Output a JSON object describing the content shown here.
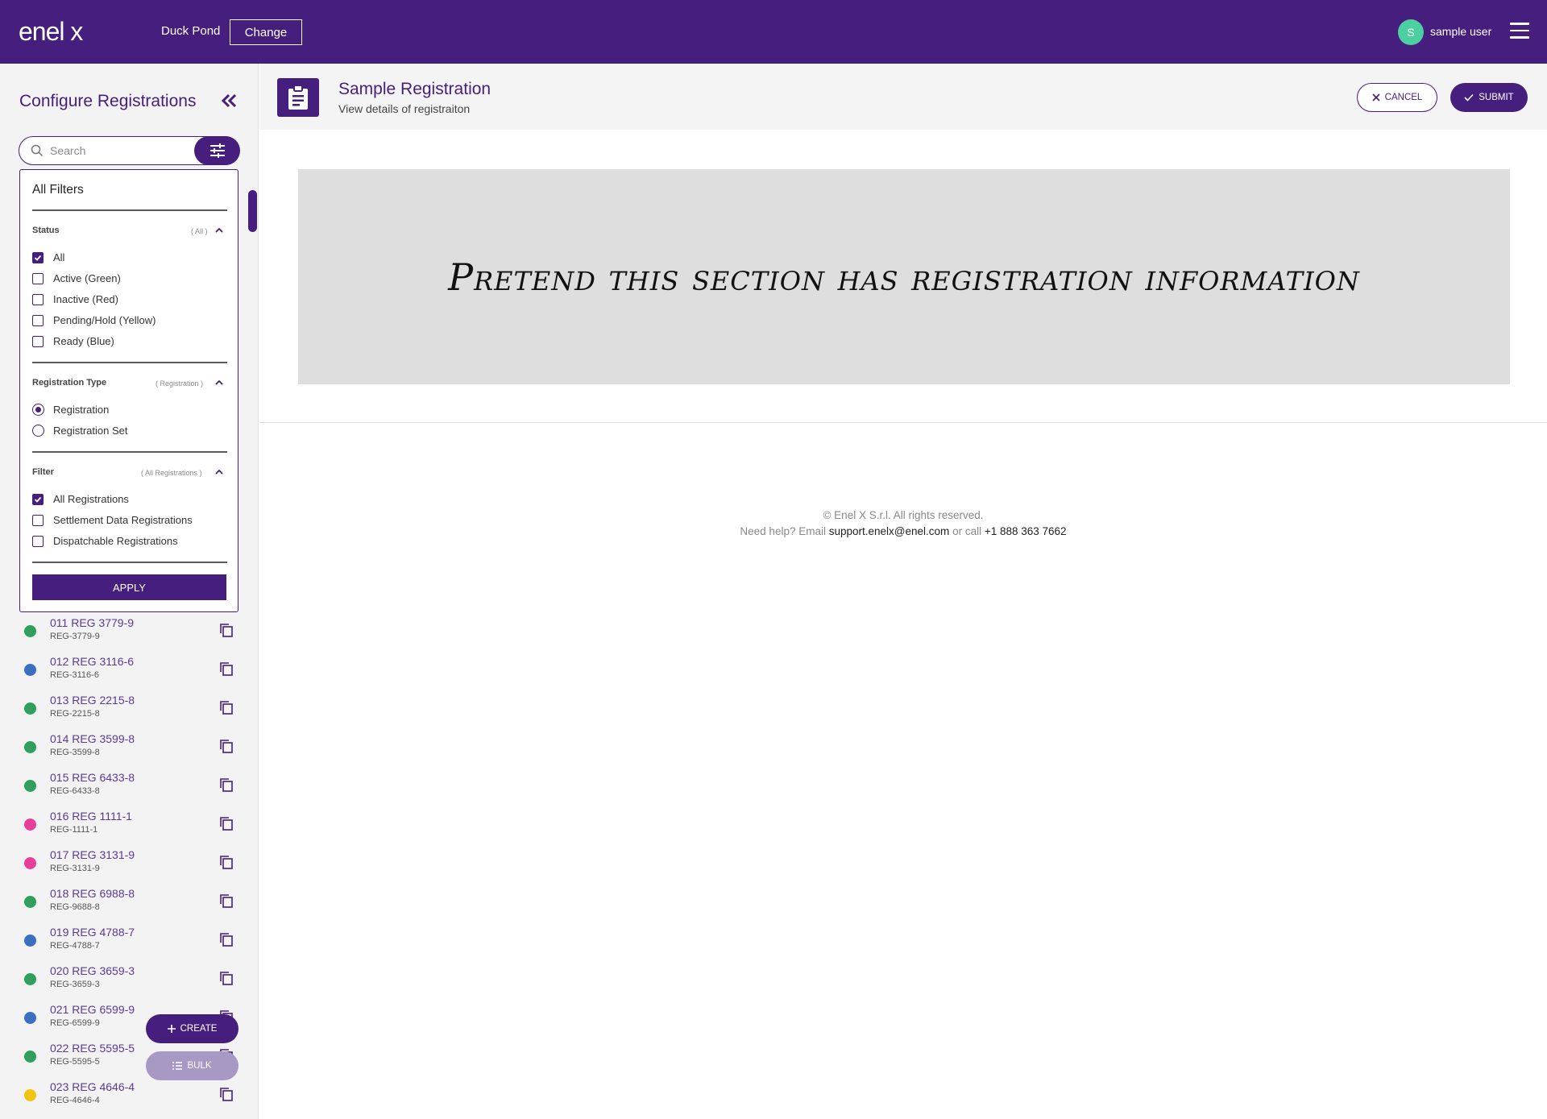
{
  "header": {
    "logo_text": "enel x",
    "site_name": "Duck Pond",
    "change_label": "Change",
    "user_initial": "S",
    "user_name": "sample user"
  },
  "sidebar": {
    "title": "Configure Registrations",
    "search_placeholder": "Search",
    "filters": {
      "title": "All Filters",
      "status": {
        "title": "Status",
        "summary": "( All )",
        "options": [
          {
            "label": "All",
            "checked": true
          },
          {
            "label": "Active (Green)",
            "checked": false
          },
          {
            "label": "Inactive (Red)",
            "checked": false
          },
          {
            "label": "Pending/Hold (Yellow)",
            "checked": false
          },
          {
            "label": "Ready (Blue)",
            "checked": false
          }
        ]
      },
      "registration_type": {
        "title": "Registration Type",
        "summary": "( Registration )",
        "options": [
          {
            "label": "Registration",
            "selected": true
          },
          {
            "label": "Registration Set",
            "selected": false
          }
        ]
      },
      "filter": {
        "title": "Filter",
        "summary": "( All Registrations )",
        "options": [
          {
            "label": "All Registrations",
            "checked": true
          },
          {
            "label": "Settlement Data Registrations",
            "checked": false
          },
          {
            "label": "Dispatchable Registrations",
            "checked": false
          }
        ]
      },
      "apply_label": "APPLY"
    },
    "registrations": [
      {
        "name": "011 REG 3779-9",
        "code": "REG-3779-9",
        "status_color": "#2ea05b"
      },
      {
        "name": "012 REG 3116-6",
        "code": "REG-3116-6",
        "status_color": "#3a6fc4"
      },
      {
        "name": "013 REG 2215-8",
        "code": "REG-2215-8",
        "status_color": "#2ea05b"
      },
      {
        "name": "014 REG 3599-8",
        "code": "REG-3599-8",
        "status_color": "#2ea05b"
      },
      {
        "name": "015 REG 6433-8",
        "code": "REG-6433-8",
        "status_color": "#2ea05b"
      },
      {
        "name": "016 REG 1111-1",
        "code": "REG-1111-1",
        "status_color": "#e8409a"
      },
      {
        "name": "017 REG 3131-9",
        "code": "REG-3131-9",
        "status_color": "#e8409a"
      },
      {
        "name": "018 REG 6988-8",
        "code": "REG-9688-8",
        "status_color": "#2ea05b"
      },
      {
        "name": "019 REG 4788-7",
        "code": "REG-4788-7",
        "status_color": "#3a6fc4"
      },
      {
        "name": "020 REG 3659-3",
        "code": "REG-3659-3",
        "status_color": "#2ea05b"
      },
      {
        "name": "021 REG 6599-9",
        "code": "REG-6599-9",
        "status_color": "#3a6fc4"
      },
      {
        "name": "022 REG 5595-5",
        "code": "REG-5595-5",
        "status_color": "#2ea05b"
      },
      {
        "name": "023 REG 4646-4",
        "code": "REG-4646-4",
        "status_color": "#f1c40f"
      }
    ],
    "create_label": "CREATE",
    "bulk_label": "BULK"
  },
  "main": {
    "title": "Sample Registration",
    "subtitle": "View details of registraiton",
    "cancel_label": "CANCEL",
    "submit_label": "SUBMIT",
    "placeholder_text": "Pretend this section has registration information"
  },
  "footer": {
    "copyright": "© Enel X S.r.l. All rights reserved.",
    "help_prefix": "Need help? Email",
    "email": "support.enelx@enel.com",
    "or_call": "or call",
    "phone": "+1 888 363 7662"
  },
  "colors": {
    "brand": "#461e7d",
    "avatar": "#4cd0a1",
    "active_green": "#2ea05b",
    "ready_blue": "#3a6fc4",
    "inactive_pink": "#e8409a",
    "pending_yellow": "#f1c40f"
  },
  "icons": [
    "enel-x-logo",
    "hamburger-menu-icon",
    "collapse-double-chevron-icon",
    "search-icon",
    "filter-sliders-icon",
    "chevron-up-icon",
    "copy-icon",
    "plus-icon",
    "list-icon",
    "clipboard-icon",
    "close-icon",
    "check-icon"
  ]
}
